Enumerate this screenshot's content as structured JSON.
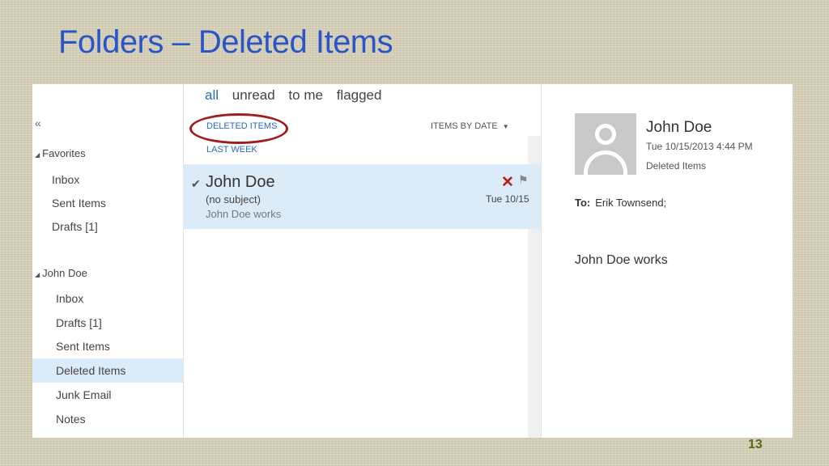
{
  "slide": {
    "title": "Folders – Deleted Items",
    "page_number": "13"
  },
  "folder_pane": {
    "collapse_icon": "«",
    "favorites_header": "Favorites",
    "favorites": [
      "Inbox",
      "Sent Items",
      "Drafts [1]"
    ],
    "account_header": "John Doe",
    "account_folders": [
      "Inbox",
      "Drafts [1]",
      "Sent Items",
      "Deleted Items",
      "Junk Email",
      "Notes"
    ],
    "selected_folder": "Deleted Items"
  },
  "message_list": {
    "filters": [
      "all",
      "unread",
      "to me",
      "flagged"
    ],
    "active_filter": "all",
    "title": "DELETED ITEMS",
    "sort_label": "ITEMS BY DATE",
    "group_header": "LAST WEEK",
    "messages": [
      {
        "sender": "John Doe",
        "subject": "(no subject)",
        "preview": "John Doe works",
        "date": "Tue 10/15"
      }
    ]
  },
  "reading_pane": {
    "sender": "John Doe",
    "datetime": "Tue 10/15/2013 4:44 PM",
    "folder": "Deleted Items",
    "to_label": "To:",
    "to_value": "Erik Townsend;",
    "body": "John Doe works"
  },
  "colors": {
    "title": "#2a55c8",
    "accent": "#2a6bbd",
    "selection": "#dcebf8",
    "annotation_circle": "#a11c1c",
    "delete_icon": "#c01818"
  }
}
